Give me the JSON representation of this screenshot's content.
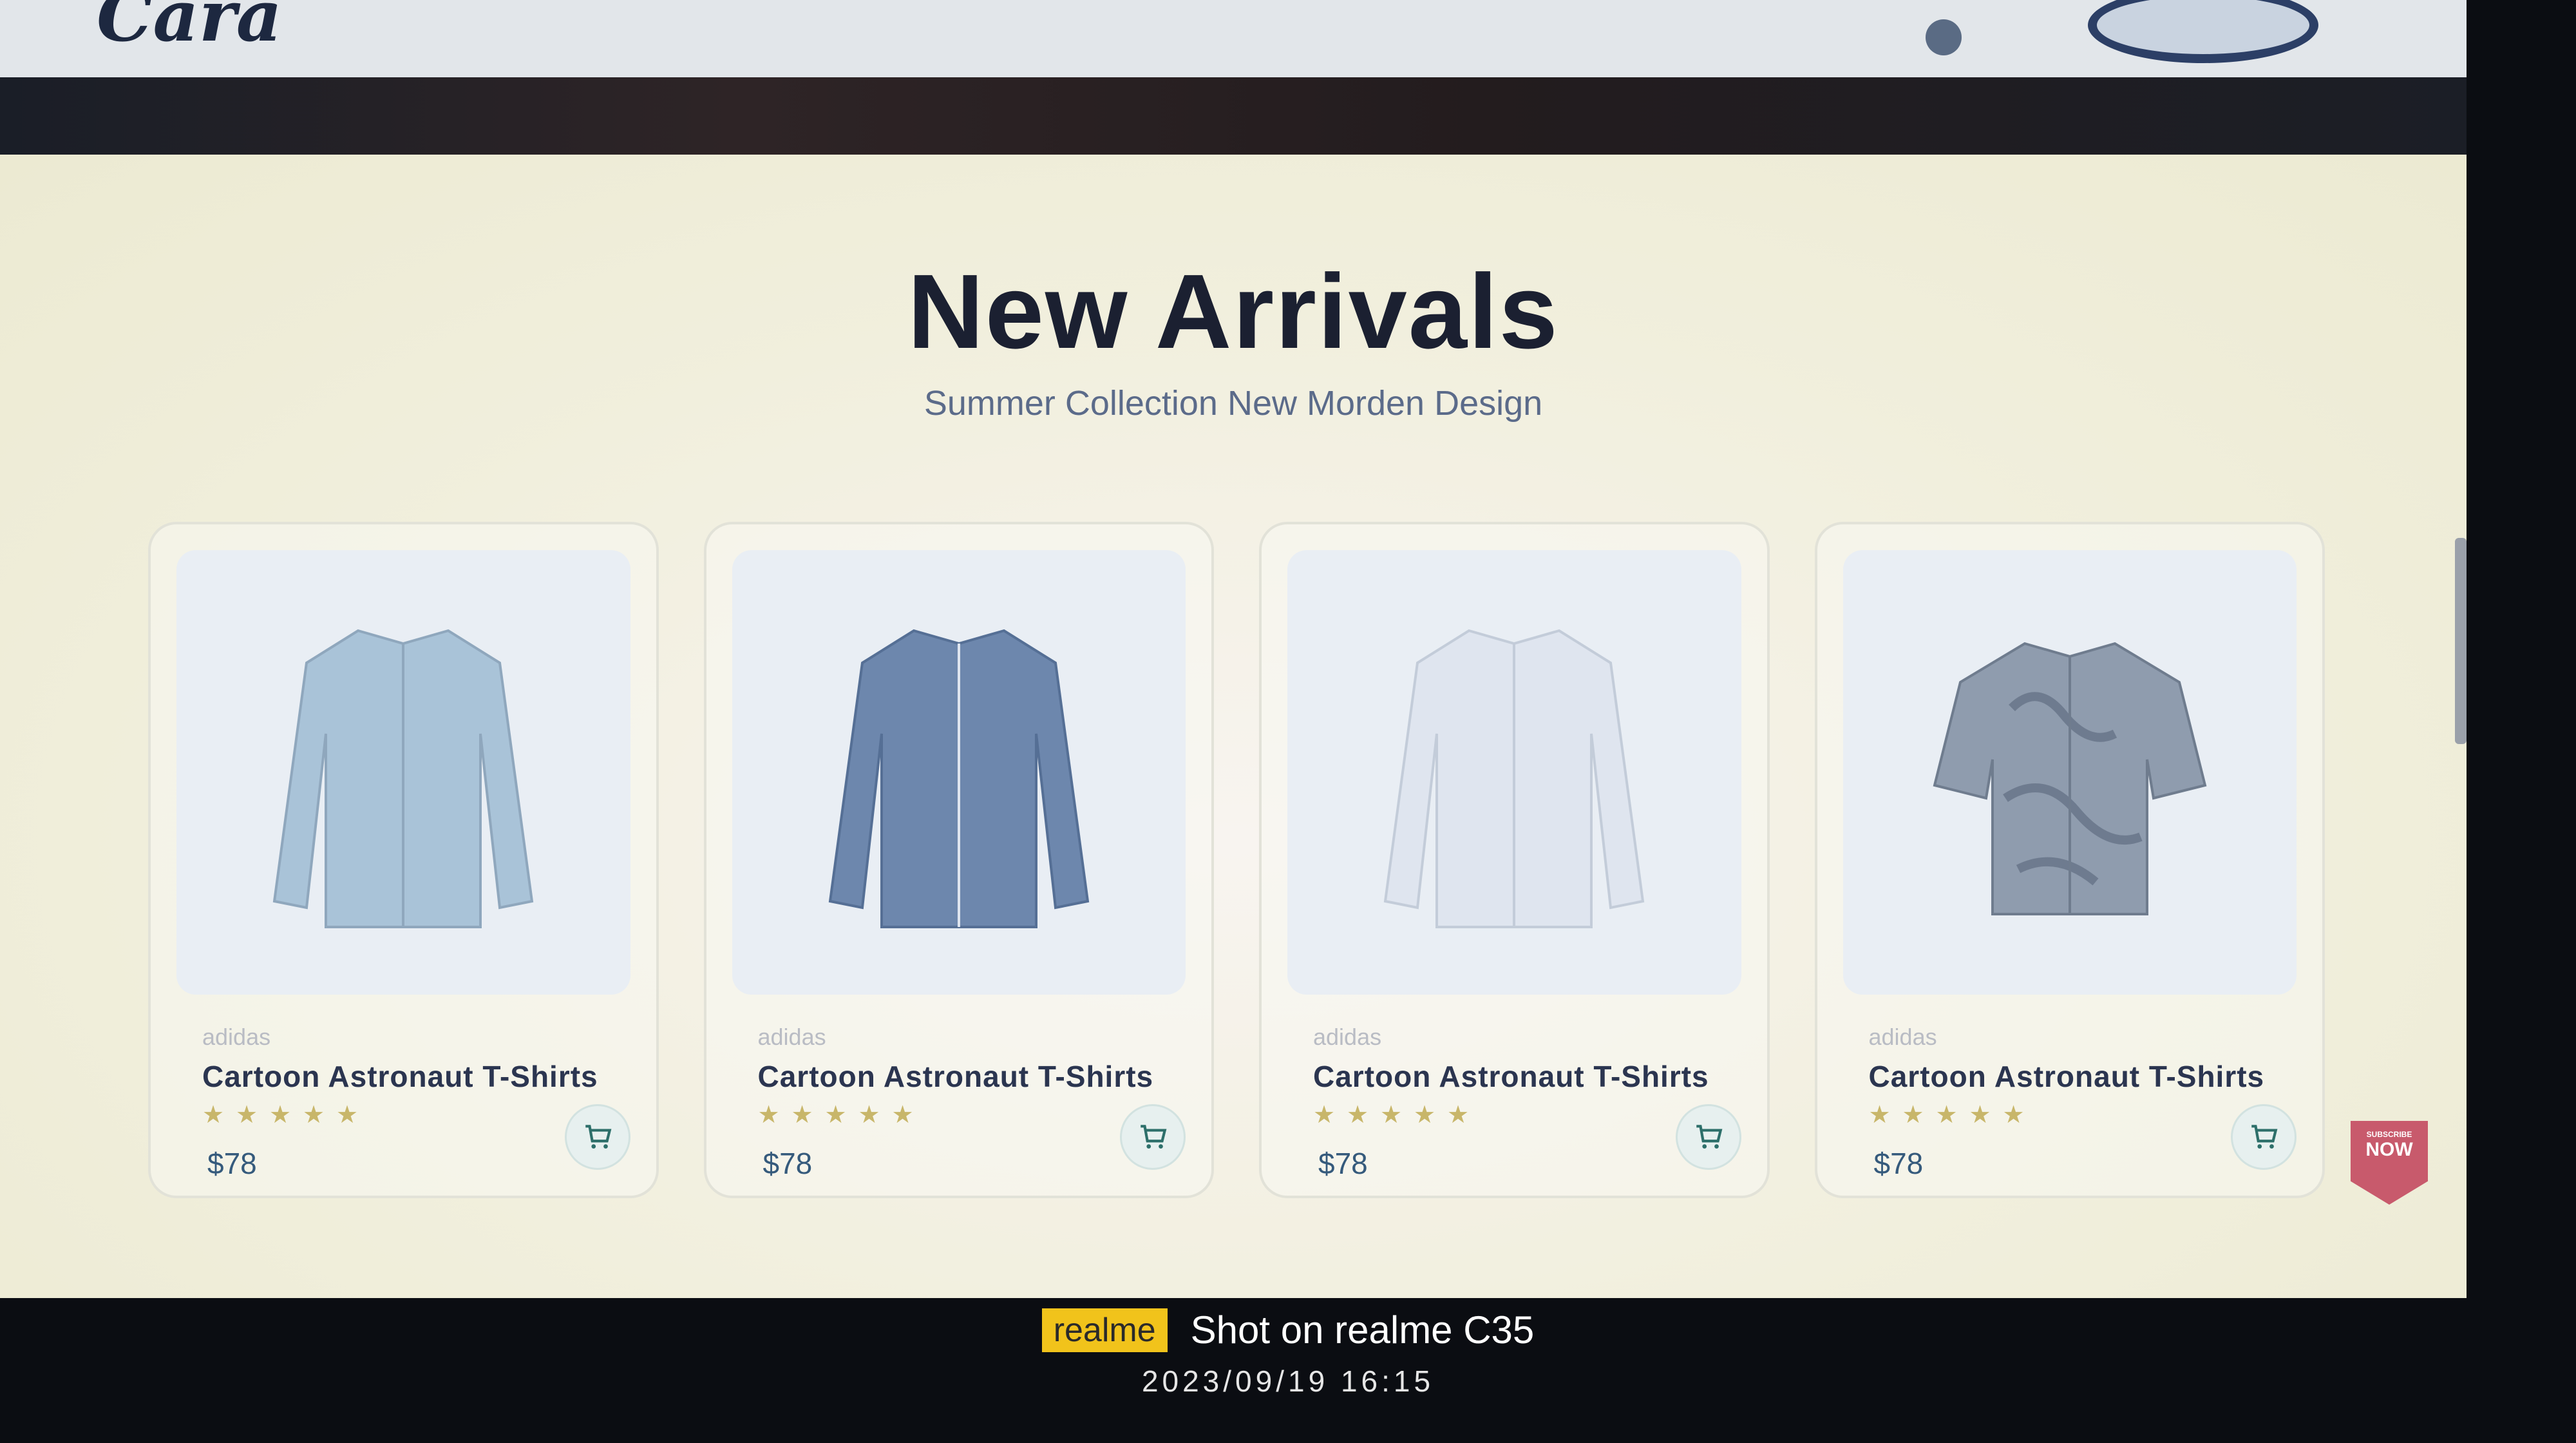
{
  "header": {
    "logo_text": "Cara"
  },
  "new_arrivals": {
    "title": "New Arrivals",
    "subtitle": "Summer Collection New Morden Design"
  },
  "products": [
    {
      "brand": "adidas",
      "name": "Cartoon Astronaut T-Shirts",
      "price": "$78",
      "rating": 5,
      "shirt_color": "#a9c3d8",
      "shirt_style": "long-sleeve"
    },
    {
      "brand": "adidas",
      "name": "Cartoon Astronaut T-Shirts",
      "price": "$78",
      "rating": 5,
      "shirt_color": "#6d87ad",
      "shirt_style": "long-sleeve"
    },
    {
      "brand": "adidas",
      "name": "Cartoon Astronaut T-Shirts",
      "price": "$78",
      "rating": 5,
      "shirt_color": "#dfe5ef",
      "shirt_style": "long-sleeve"
    },
    {
      "brand": "adidas",
      "name": "Cartoon Astronaut T-Shirts",
      "price": "$78",
      "rating": 5,
      "shirt_color": "#8f9cae",
      "shirt_style": "short-sleeve-floral"
    }
  ],
  "icons": {
    "star": "star-icon",
    "cart": "cart-icon"
  },
  "subscribe_badge": {
    "small_text": "SUBSCRIBE",
    "big_text": "NOW"
  },
  "camera_watermark": {
    "brand": "realme",
    "shot_text": "Shot on realme C35",
    "timestamp": "2023/09/19  16:15"
  }
}
